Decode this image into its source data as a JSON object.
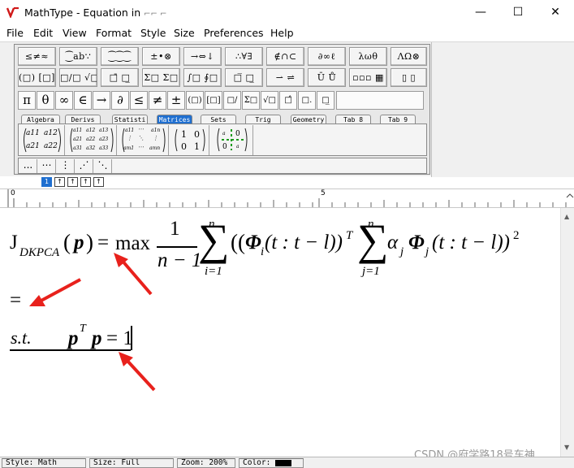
{
  "window": {
    "title": "MathType - Equation in",
    "title_obscured": "⌐⌐  ⌐",
    "minimize": "—",
    "maximize": "☐",
    "close": "✕"
  },
  "menu": [
    "File",
    "Edit",
    "View",
    "Format",
    "Style",
    "Size",
    "Preferences",
    "Help"
  ],
  "toolbar": {
    "row1": [
      "≤≠≈",
      "⁐ab∵",
      "⁐⁐⁐",
      "±•⊗",
      "→⇔↓",
      "∴∀∃",
      "∉∩⊂",
      "∂∞ℓ",
      "λωθ",
      "ΛΩ⊗"
    ],
    "row2": [
      "(□) [□]",
      "□/□ √□",
      "□̄ □̲",
      "Σ□ Σ□",
      "∫□ ∮□",
      "□̅ □̲",
      "⇀ ⇌",
      "Ū Ů",
      "▫▫▫ ▦",
      "▯ ▯"
    ],
    "row3": [
      "π",
      "θ",
      "∞",
      "∈",
      "→",
      "∂",
      "≤",
      "≠",
      "±",
      "(□)",
      "[□]",
      "□/□",
      "Σ□",
      "√□",
      "□̂",
      "□.",
      "□̲"
    ],
    "tabs": [
      "Algebra",
      "Derivs",
      "Statisti",
      "Matrices",
      "Sets",
      "Trig",
      "Geometry",
      "Tab 8",
      "Tab 9"
    ],
    "active_tab": "Matrices",
    "dots": [
      "...",
      "⋯",
      "⋮",
      "⋰",
      "⋱"
    ]
  },
  "matrices": {
    "m1": [
      "a11",
      "a12",
      "a21",
      "a22"
    ],
    "m2": [
      "a11",
      "a12",
      "a13",
      "a21",
      "a22",
      "a23",
      "a31",
      "a32",
      "a33"
    ],
    "m3": [
      "a11",
      "⋯",
      "a1n",
      "⋮",
      "⋱",
      "⋮",
      "am1",
      "⋯",
      "amn"
    ],
    "identity": [
      "1",
      "0",
      "0",
      "1"
    ]
  },
  "size_buttons": [
    "1",
    "↑",
    "↑",
    "↑",
    "↑"
  ],
  "ruler": {
    "mark0": "0",
    "mark5": "5"
  },
  "equation": {
    "J": "J",
    "subscript": "DKPCA",
    "lparen": "(",
    "p": "p",
    "rparen": ")",
    "eq": "=",
    "max": "max",
    "frac_num": "1",
    "frac_den": "n − 1",
    "sum1_top": "n",
    "sum1_bottom": "i=1",
    "body1": "((",
    "Phi": "Φ",
    "sub_i": "i",
    "args1": "(t : t − l))",
    "sup_T": "T",
    "sum2_top": "n",
    "sum2_bottom": "j=1",
    "alpha": "α",
    "sub_j": "j",
    "Phi2": "Φ",
    "sub_j2": "j",
    "args2": "(t : t − l))",
    "sup_2": "2",
    "line2": "=",
    "st": "s.t.",
    "constraint_p1": "p",
    "constraint_T": "T",
    "constraint_p2": "p",
    "constraint_eq": "= 1"
  },
  "status": {
    "style": "Style: Math",
    "size": "Size: Full",
    "zoom": "Zoom: 200%",
    "color": "Color:"
  },
  "watermark": "CSDN @府学路18号车神",
  "colors": {
    "accent": "#1f6fd0",
    "arrow": "#e8211c",
    "logo": "#d01818"
  }
}
